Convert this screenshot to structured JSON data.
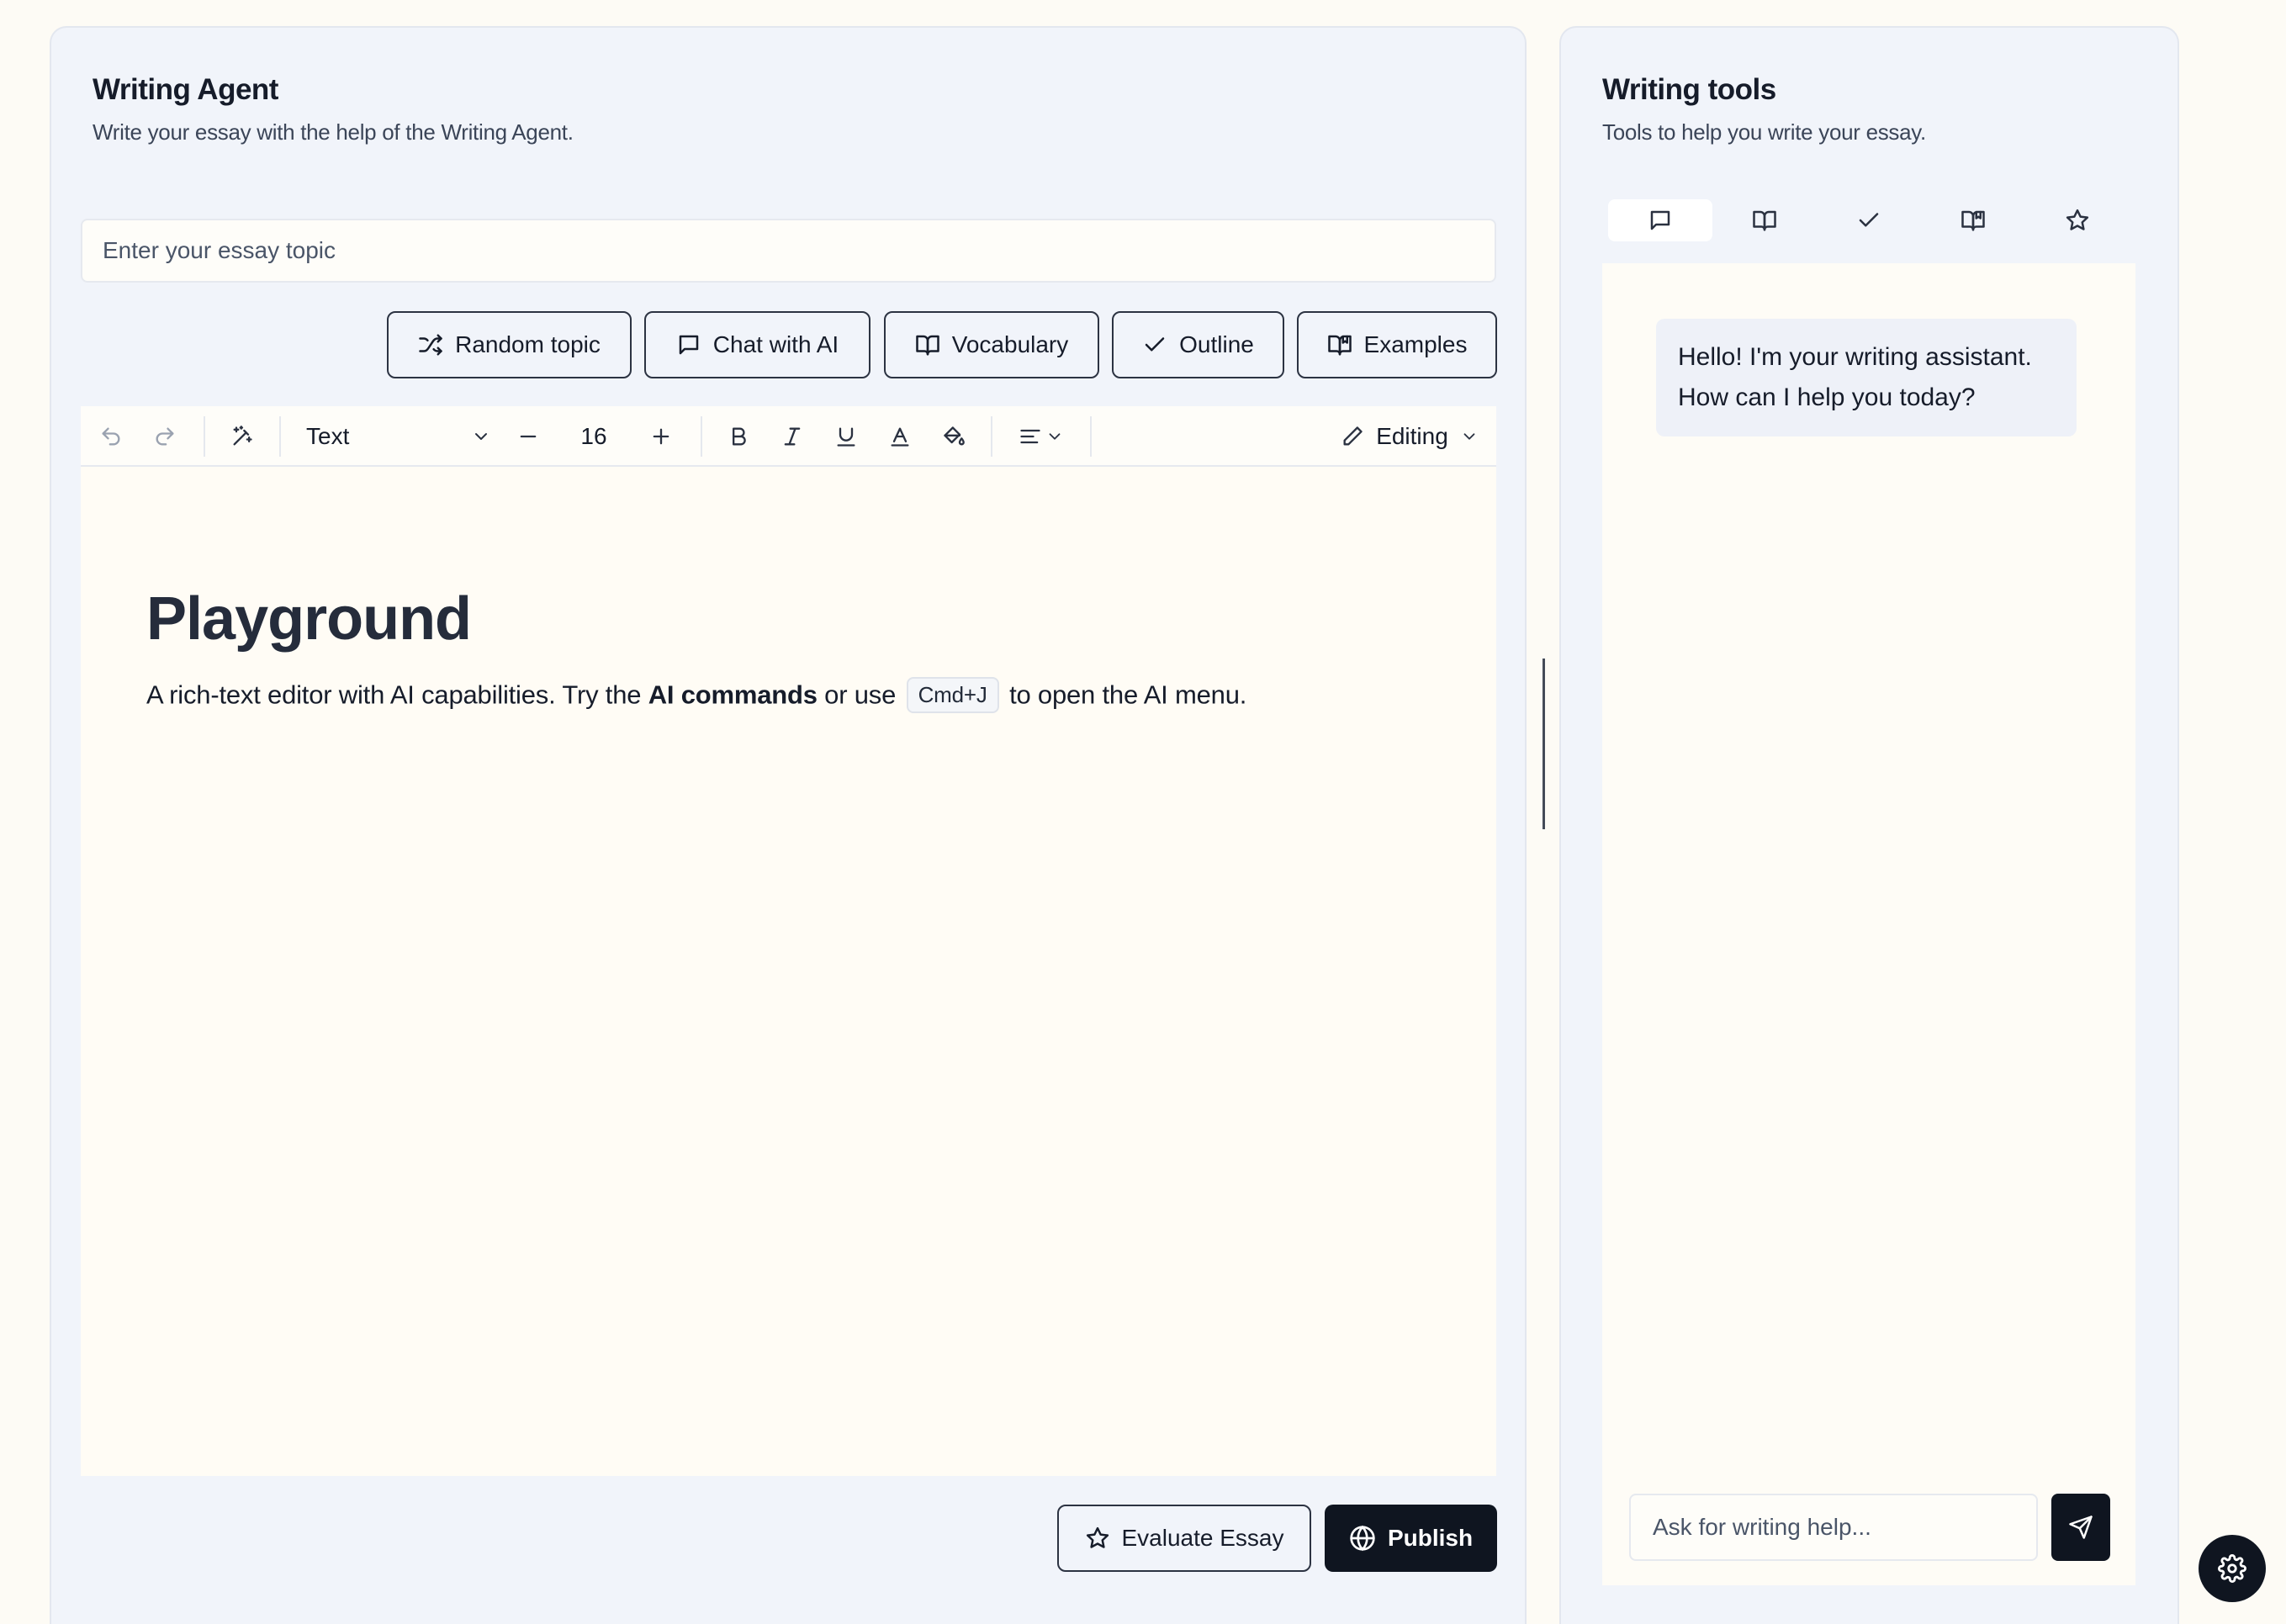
{
  "writing_agent": {
    "title": "Writing Agent",
    "subtitle": "Write your essay with the help of the Writing Agent.",
    "topic_placeholder": "Enter your essay topic",
    "actions": {
      "random_topic": "Random topic",
      "chat_with_ai": "Chat with AI",
      "vocabulary": "Vocabulary",
      "outline": "Outline",
      "examples": "Examples"
    },
    "toolbar": {
      "block_type": "Text",
      "font_size": "16",
      "mode": "Editing"
    },
    "editor": {
      "heading": "Playground",
      "paragraph_before": "A rich-text editor with AI capabilities. Try the ",
      "paragraph_bold": "AI commands",
      "paragraph_middle": " or use ",
      "shortcut": "Cmd+J",
      "paragraph_after": " to open the AI menu."
    },
    "footer": {
      "evaluate": "Evaluate Essay",
      "publish": "Publish"
    }
  },
  "writing_tools": {
    "title": "Writing tools",
    "subtitle": "Tools to help you write your essay.",
    "tabs": [
      "chat-icon",
      "book-open-icon",
      "check-icon",
      "book-marked-icon",
      "star-icon"
    ],
    "assistant_message_line1": "Hello! I'm your writing assistant.",
    "assistant_message_line2": "How can I help you today?",
    "chat_placeholder": "Ask for writing help..."
  },
  "colors": {
    "primary_dark": "#0f1520",
    "panel_bg": "#f1f4fa",
    "page_bg": "#fdfbf5"
  }
}
